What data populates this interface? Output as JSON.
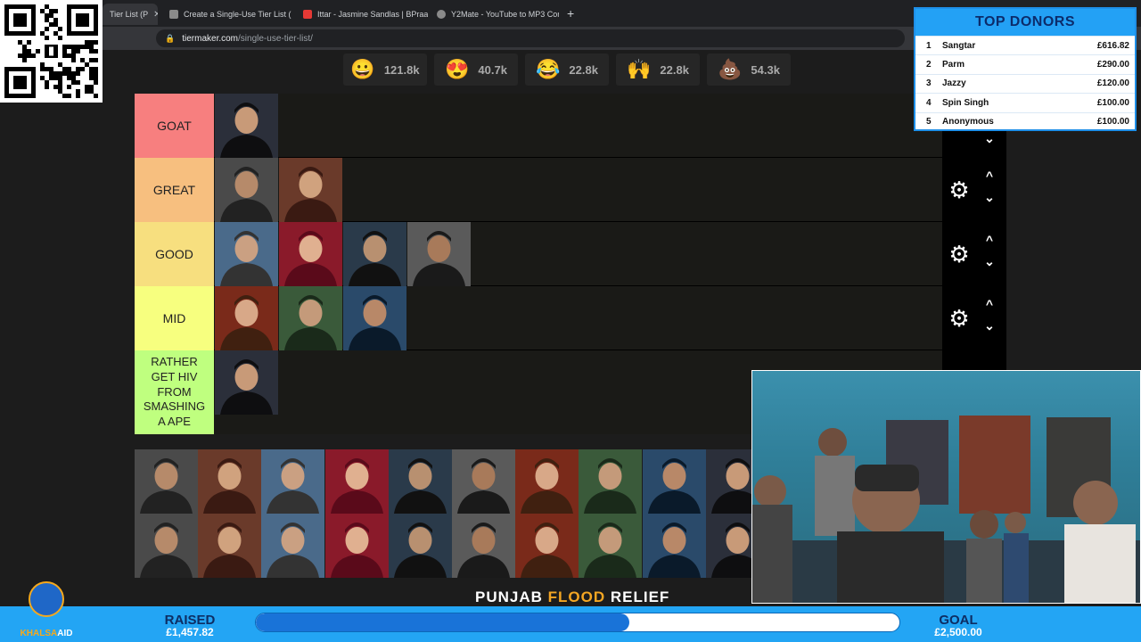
{
  "browser": {
    "tabs": [
      {
        "label": "Tier List (P",
        "color": "#4285f4"
      },
      {
        "label": "Create a Single-Use Tier List (P",
        "color": "#8a8a8a"
      },
      {
        "label": "Ittar - Jasmine Sandlas | BPraak",
        "color": "#e53935"
      },
      {
        "label": "Y2Mate - YouTube to MP3 Conv",
        "color": "#8a8a8a"
      }
    ],
    "new_tab": "+",
    "url_domain": "tiermaker.com",
    "url_path": "/single-use-tier-list/"
  },
  "reactions": [
    {
      "icon": "grin-emoji-icon",
      "glyph": "😀",
      "count": "121.8k"
    },
    {
      "icon": "heart-eyes-emoji-icon",
      "glyph": "😍",
      "count": "40.7k"
    },
    {
      "icon": "laugh-emoji-icon",
      "glyph": "😂",
      "count": "22.8k"
    },
    {
      "icon": "raised-hands-emoji-icon",
      "glyph": "🙌",
      "count": "22.8k"
    },
    {
      "icon": "poop-emoji-icon",
      "glyph": "💩",
      "count": "54.3k"
    }
  ],
  "tiers": [
    {
      "label": "GOAT",
      "color": "#f77f7f",
      "items": 1
    },
    {
      "label": "GREAT",
      "color": "#f7bf7f",
      "items": 2
    },
    {
      "label": "GOOD",
      "color": "#f7df7f",
      "items": 4
    },
    {
      "label": "MID",
      "color": "#f7ff7f",
      "items": 3
    },
    {
      "label": "RATHER GET HIV FROM SMASHING A APE",
      "color": "#bfff7f",
      "items": 1
    }
  ],
  "pool_count": 21,
  "donors": {
    "title": "TOP DONORS",
    "list": [
      {
        "rank": "1",
        "name": "Sangtar",
        "amount": "£616.82"
      },
      {
        "rank": "2",
        "name": "Parm",
        "amount": "£290.00"
      },
      {
        "rank": "3",
        "name": "Jazzy",
        "amount": "£120.00"
      },
      {
        "rank": "4",
        "name": "Spin Singh",
        "amount": "£100.00"
      },
      {
        "rank": "5",
        "name": "Anonymous",
        "amount": "£100.00"
      }
    ]
  },
  "fundraiser": {
    "banner_pre": "PUNJAB ",
    "banner_hl": "FLOOD",
    "banner_post": " RELIEF",
    "raised_label": "RAISED",
    "raised_value": "£1,457.82",
    "goal_label": "GOAL",
    "goal_value": "£2,500.00",
    "progress_fraction": 0.58,
    "logo_text_a": "KHALSA",
    "logo_text_b": "AID"
  },
  "colors": {
    "accent": "#23a5f4",
    "progress": "#1973d8"
  }
}
